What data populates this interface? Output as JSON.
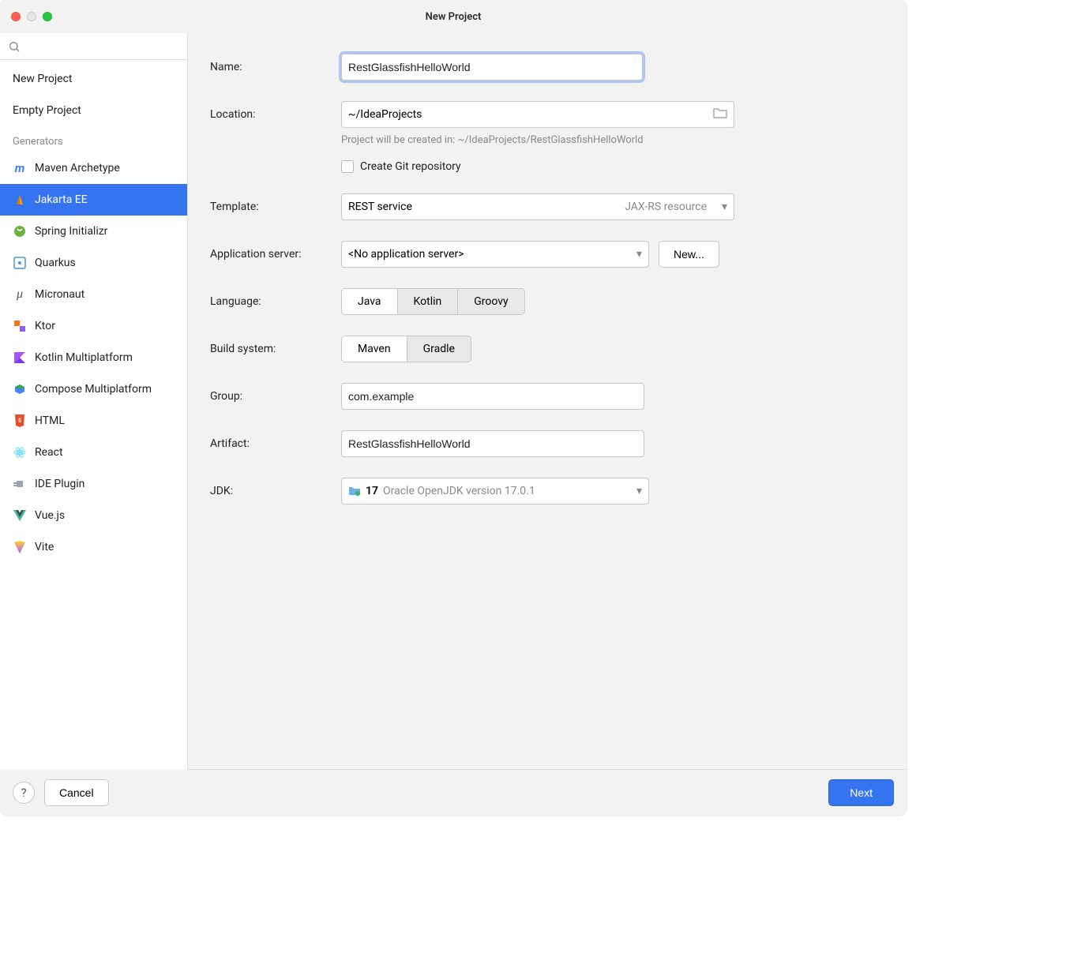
{
  "window": {
    "title": "New Project"
  },
  "sidebar": {
    "items": [
      "New Project",
      "Empty Project"
    ],
    "generators_header": "Generators",
    "generators": [
      "Maven Archetype",
      "Jakarta EE",
      "Spring Initializr",
      "Quarkus",
      "Micronaut",
      "Ktor",
      "Kotlin Multiplatform",
      "Compose Multiplatform",
      "HTML",
      "React",
      "IDE Plugin",
      "Vue.js",
      "Vite"
    ],
    "selected_index": 1
  },
  "form": {
    "name_label": "Name:",
    "name_value": "RestGlassfishHelloWorld",
    "location_label": "Location:",
    "location_value": "~/IdeaProjects",
    "location_hint": "Project will be created in: ~/IdeaProjects/RestGlassfishHelloWorld",
    "git_label": "Create Git repository",
    "template_label": "Template:",
    "template_value": "REST service",
    "template_right": "JAX-RS resource",
    "appserver_label": "Application server:",
    "appserver_value": "<No application server>",
    "new_btn": "New...",
    "language_label": "Language:",
    "language_options": [
      "Java",
      "Kotlin",
      "Groovy"
    ],
    "buildsys_label": "Build system:",
    "buildsys_options": [
      "Maven",
      "Gradle"
    ],
    "group_label": "Group:",
    "group_value": "com.example",
    "artifact_label": "Artifact:",
    "artifact_value": "RestGlassfishHelloWorld",
    "jdk_label": "JDK:",
    "jdk_version": "17",
    "jdk_desc": "Oracle OpenJDK version 17.0.1"
  },
  "footer": {
    "cancel": "Cancel",
    "next": "Next"
  }
}
